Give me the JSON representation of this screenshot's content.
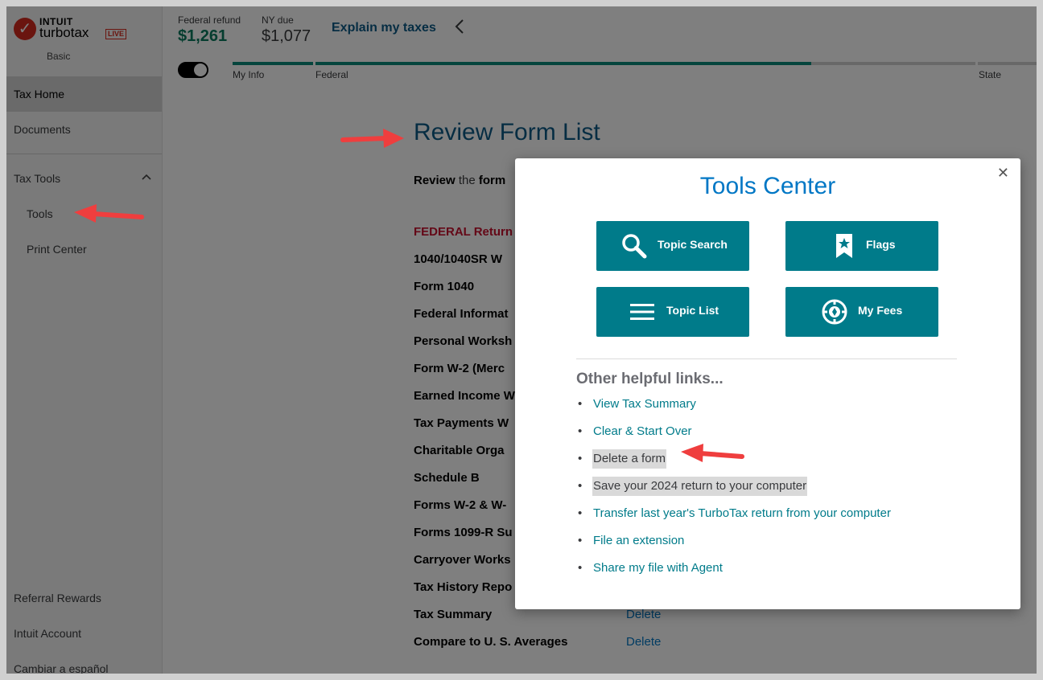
{
  "sidebar": {
    "logo": {
      "intuit": "INTUIT",
      "brand": "turbotax",
      "live": "LIVE",
      "edition": "Basic"
    },
    "items": [
      {
        "label": "Tax Home"
      },
      {
        "label": "Documents"
      },
      {
        "label": "Tax Tools"
      },
      {
        "label": "Tools"
      },
      {
        "label": "Print Center"
      },
      {
        "label": "Referral Rewards"
      },
      {
        "label": "Intuit Account"
      },
      {
        "label": "Cambiar a español"
      }
    ]
  },
  "header": {
    "federal": {
      "label": "Federal refund",
      "amount": "$1,261",
      "color": "#0a7a5f"
    },
    "state": {
      "label": "NY due",
      "amount": "$1,077",
      "color": "#393a3d"
    },
    "explain_link": "Explain my taxes",
    "progress": [
      {
        "label": "My Info"
      },
      {
        "label": "Federal"
      },
      {
        "label": "State"
      }
    ]
  },
  "main": {
    "title": "Review Form List",
    "review_bold": "Review",
    "review_rest": " the ",
    "review_bold2": "form",
    "federal_heading": "FEDERAL Return",
    "delete_label": "Delete",
    "forms": [
      "1040/1040SR W",
      "Form 1040",
      "Federal Informat",
      "Personal Worksh",
      "Form W-2 (Merc",
      "Earned Income W",
      "Tax Payments W",
      "Charitable Orga",
      "Schedule B",
      "Forms W-2 & W-",
      "Forms 1099-R Su",
      "Carryover Works",
      "Tax History Repo",
      "Tax Summary",
      "Compare to U. S. Averages"
    ]
  },
  "modal": {
    "title": "Tools Center",
    "buttons": [
      {
        "label": "Topic Search",
        "icon": "magnifier-icon"
      },
      {
        "label": "Flags",
        "icon": "bookmark-star-icon"
      },
      {
        "label": "Topic List",
        "icon": "list-icon"
      },
      {
        "label": "My Fees",
        "icon": "fees-icon"
      }
    ],
    "links_heading": "Other helpful links...",
    "links": [
      "View Tax Summary",
      "Clear & Start Over",
      "Delete a form",
      "Save your 2024 return to your computer",
      "Transfer last year's TurboTax return from your computer",
      "File an extension",
      "Share my file with Agent"
    ],
    "colors": {
      "button": "#007b8a",
      "title": "#0077c5",
      "link": "#007b8a"
    }
  },
  "annotation_color": "#ef3e3e"
}
